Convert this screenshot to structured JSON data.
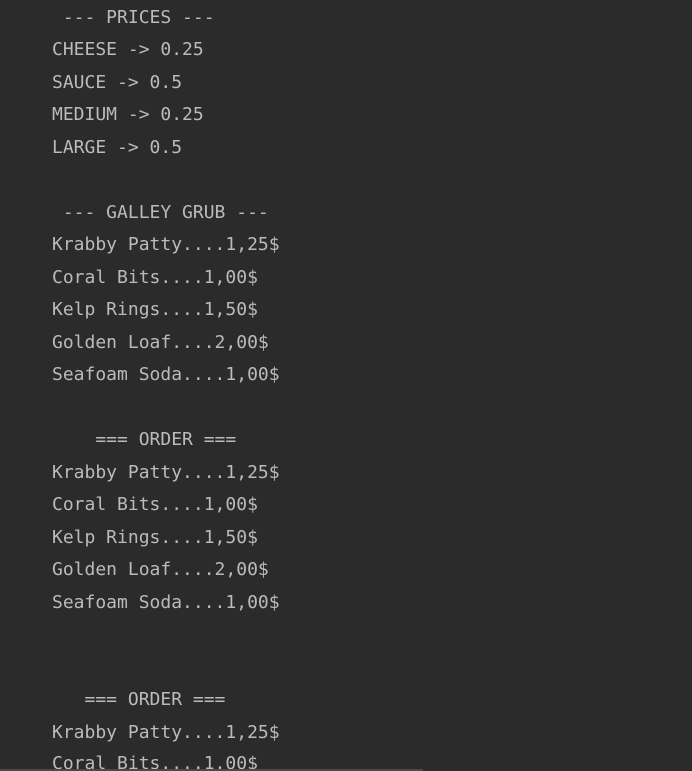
{
  "console": {
    "lines": [
      " --- PRICES ---",
      "CHEESE -> 0.25",
      "SAUCE -> 0.5",
      "MEDIUM -> 0.25",
      "LARGE -> 0.5",
      " --- GALLEY GRUB ---",
      "Krabby Patty....1,25$",
      "Coral Bits....1,00$",
      "Kelp Rings....1,50$",
      "Golden Loaf....2,00$",
      "Seafoam Soda....1,00$",
      "    === ORDER ===",
      "Krabby Patty....1,25$",
      "Coral Bits....1,00$",
      "Kelp Rings....1,50$",
      "Golden Loaf....2,00$",
      "Seafoam Soda....1,00$",
      "   === ORDER ===",
      "Krabby Patty....1,25$",
      "Coral Bits....1,00$"
    ]
  }
}
